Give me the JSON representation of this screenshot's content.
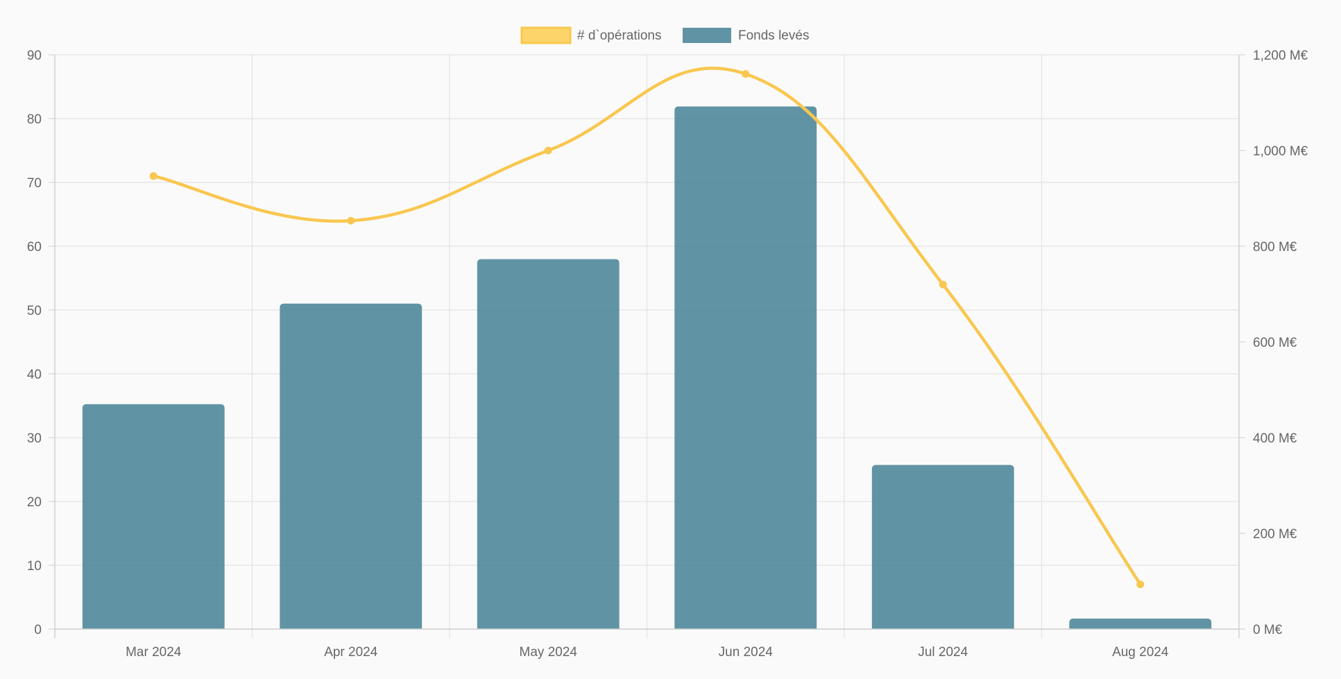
{
  "chart_data": {
    "type": "bar",
    "categories": [
      "Mar 2024",
      "Apr 2024",
      "May 2024",
      "Jun 2024",
      "Jul 2024",
      "Aug 2024"
    ],
    "series": [
      {
        "name": "# d`opérations",
        "type": "line",
        "axis": "left",
        "color": "#f9c74f",
        "values": [
          71,
          64,
          75,
          87,
          54,
          7
        ]
      },
      {
        "name": "Fonds levés",
        "type": "bar",
        "axis": "right",
        "color": "#4a8599",
        "values": [
          470,
          680,
          773,
          1092,
          343,
          22
        ]
      }
    ],
    "left_axis": {
      "ylim": [
        0,
        90
      ],
      "ticks": [
        "0",
        "10",
        "20",
        "30",
        "40",
        "50",
        "60",
        "70",
        "80",
        "90"
      ]
    },
    "right_axis": {
      "ylim": [
        0,
        1200
      ],
      "ticks": [
        "0 M€",
        "200 M€",
        "400 M€",
        "600 M€",
        "800 M€",
        "1,000 M€",
        "1,200 M€"
      ]
    },
    "grid": true,
    "legend_position": "top-center"
  }
}
